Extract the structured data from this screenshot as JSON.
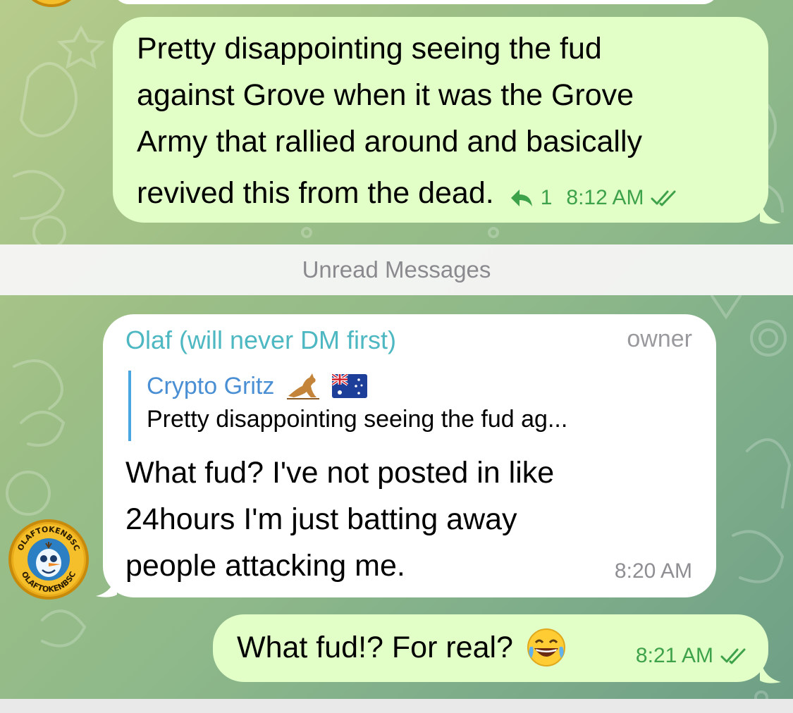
{
  "theme": {
    "outgoing_bubble": "#e1ffc7",
    "incoming_bubble": "#ffffff",
    "accent_green": "#3ea24a",
    "sender_color": "#4db7c2",
    "reply_color": "#4a8fd4"
  },
  "messages": {
    "first": {
      "lines": [
        "Pretty disappointing seeing the fud",
        "against Grove when it was the Grove",
        "Army that rallied around and basically",
        "revived this from the dead."
      ],
      "reply_count": "1",
      "time": "8:12 AM"
    },
    "separator": "Unread Messages",
    "second": {
      "sender": "Olaf (will never DM first)",
      "role": "owner",
      "reply_to_name": "Crypto Gritz",
      "reply_to_text": "Pretty disappointing seeing the fud ag...",
      "lines": [
        "What fud? I've not posted in like",
        "24hours I'm just batting away",
        "people attacking me."
      ],
      "time": "8:20 AM",
      "avatar_text": "OLAFTOKENBSC"
    },
    "third": {
      "text": "What fud!? For real?",
      "emoji": "😂",
      "time": "8:21 AM"
    }
  },
  "icons": {
    "reply": "reply-arrow-icon",
    "read": "double-check-icon",
    "kangaroo": "kangaroo-emoji",
    "flag": "australia-flag-emoji"
  }
}
